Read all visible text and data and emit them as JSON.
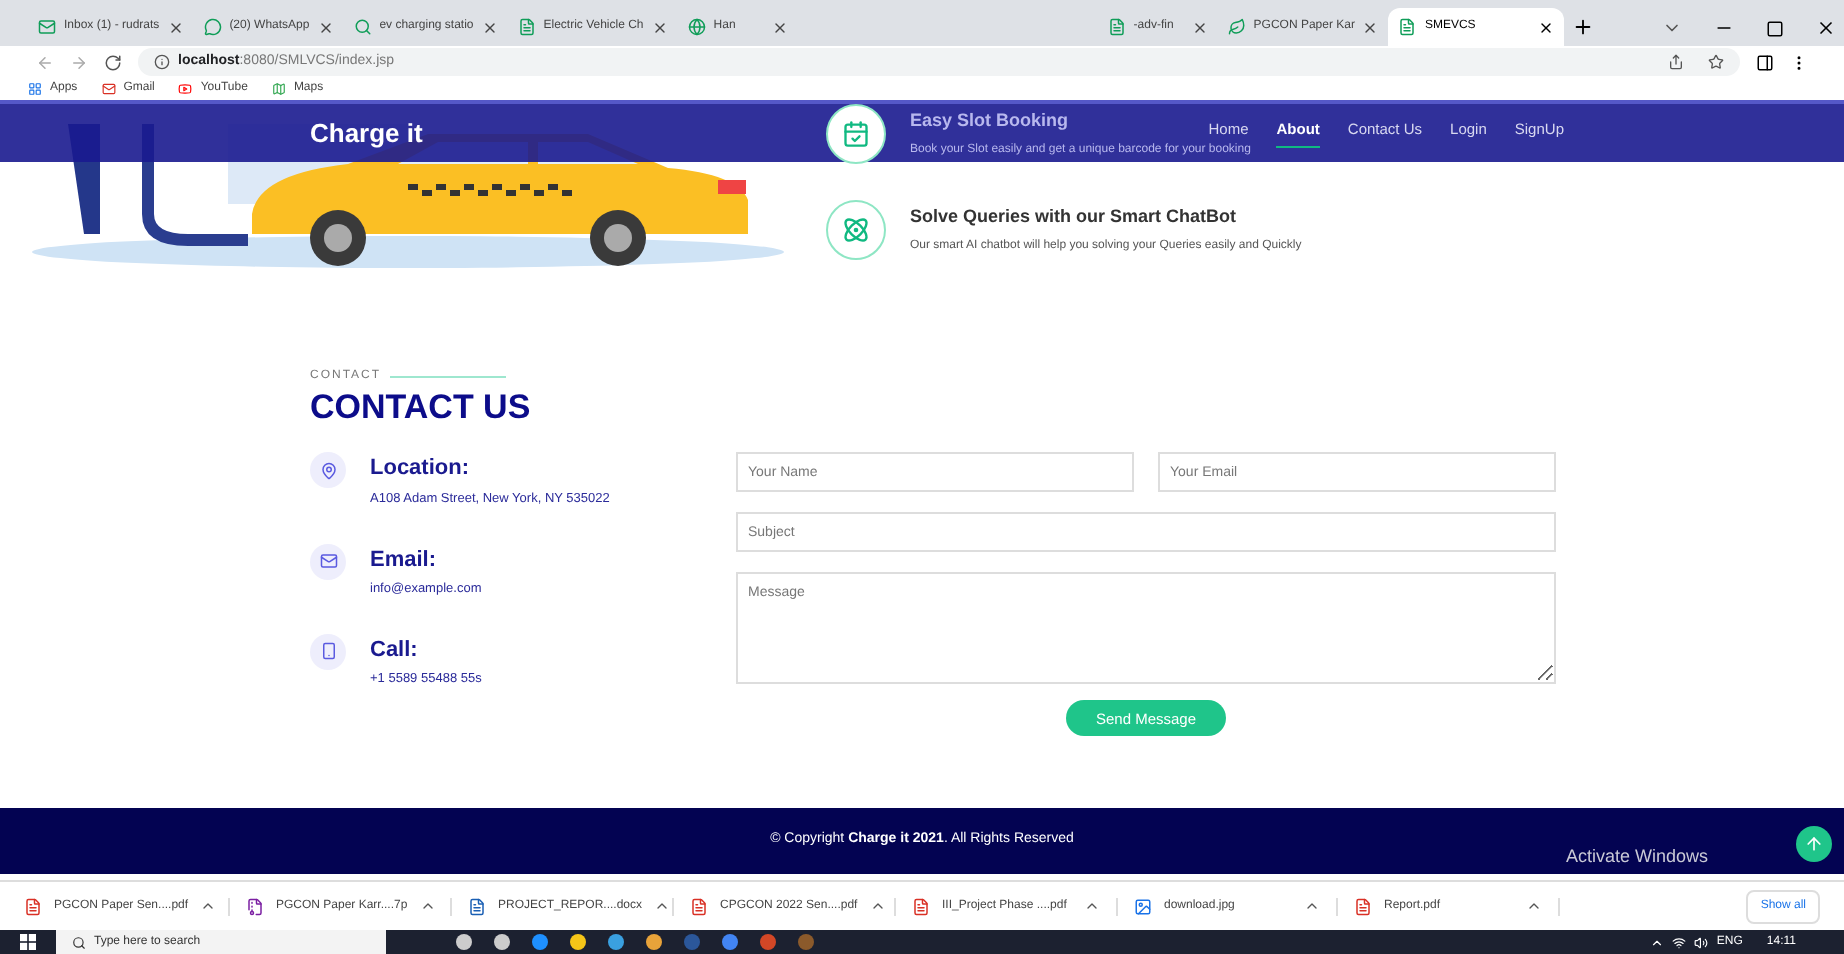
{
  "browser": {
    "tabs": [
      {
        "kind": "mail",
        "title": "Inbox (1) - rudrats",
        "selected": false
      },
      {
        "kind": "chat",
        "title": "(20) WhatsApp",
        "selected": false
      },
      {
        "kind": "search",
        "title": "ev charging statio",
        "selected": false
      },
      {
        "kind": "page",
        "title": "Electric Vehicle Ch",
        "selected": false
      },
      {
        "kind": "globe",
        "title": "Han",
        "selected": false
      },
      {
        "kind": "page",
        "title": "-adv-fin",
        "selected": false
      },
      {
        "kind": "leaf",
        "title": "PGCON Paper Kar",
        "selected": false
      },
      {
        "kind": "page",
        "title": "SMEVCS",
        "selected": true
      }
    ],
    "url_host": "localhost",
    "url_path": ":8080/SMLVCS/index.jsp",
    "bookmarks": [
      {
        "kind": "apps",
        "label": "Apps"
      },
      {
        "kind": "mail",
        "label": "Gmail"
      },
      {
        "kind": "video",
        "label": "YouTube"
      },
      {
        "kind": "map",
        "label": "Maps"
      }
    ]
  },
  "header": {
    "brand": "Charge it",
    "nav": [
      {
        "label": "Home",
        "selected": false
      },
      {
        "label": "About",
        "selected": true
      },
      {
        "label": "Contact Us",
        "selected": false
      },
      {
        "label": "Login",
        "selected": false
      },
      {
        "label": "SignUp",
        "selected": false
      }
    ]
  },
  "features": [
    {
      "kind": "booking",
      "title": "Easy Slot Booking",
      "text": "Book your Slot easily and get a unique barcode for your booking"
    },
    {
      "kind": "chatbot",
      "title": "Solve Queries with our Smart ChatBot",
      "text": "Our smart AI chatbot will help you solving your Queries easily and Quickly"
    }
  ],
  "contact": {
    "eyebrow": "CONTACT",
    "heading": "CONTACT US",
    "info": [
      {
        "kind": "location",
        "label": "Location:",
        "value": "A108 Adam Street, New York, NY 535022"
      },
      {
        "kind": "email",
        "label": "Email:",
        "value": "info@example.com"
      },
      {
        "kind": "phone",
        "label": "Call:",
        "value": "+1 5589 55488 55s"
      }
    ],
    "form": {
      "name_placeholder": "Your Name",
      "email_placeholder": "Your Email",
      "subject_placeholder": "Subject",
      "message_placeholder": "Message",
      "button": "Send Message"
    }
  },
  "footer": {
    "copyright": "© Copyright **Charge it 2021**. All Rights Reserved"
  },
  "os_notice": "Activate Windows",
  "downloads": {
    "items": [
      {
        "kind": "pdf",
        "name": "PGCON Paper Sen....pdf"
      },
      {
        "kind": "archive",
        "name": "PGCON Paper Karr....7p"
      },
      {
        "kind": "doc",
        "name": "PROJECT_REPOR....docx"
      },
      {
        "kind": "pdf",
        "name": "CPGCON 2022 Sen....pdf"
      },
      {
        "kind": "pdf",
        "name": "III_Project Phase ....pdf"
      },
      {
        "kind": "image",
        "name": "download.jpg"
      },
      {
        "kind": "pdf",
        "name": "Report.pdf"
      }
    ],
    "show_all": "Show all"
  },
  "taskbar": {
    "search_placeholder": "Type here to search",
    "language": "ENG",
    "time": "14:11"
  }
}
